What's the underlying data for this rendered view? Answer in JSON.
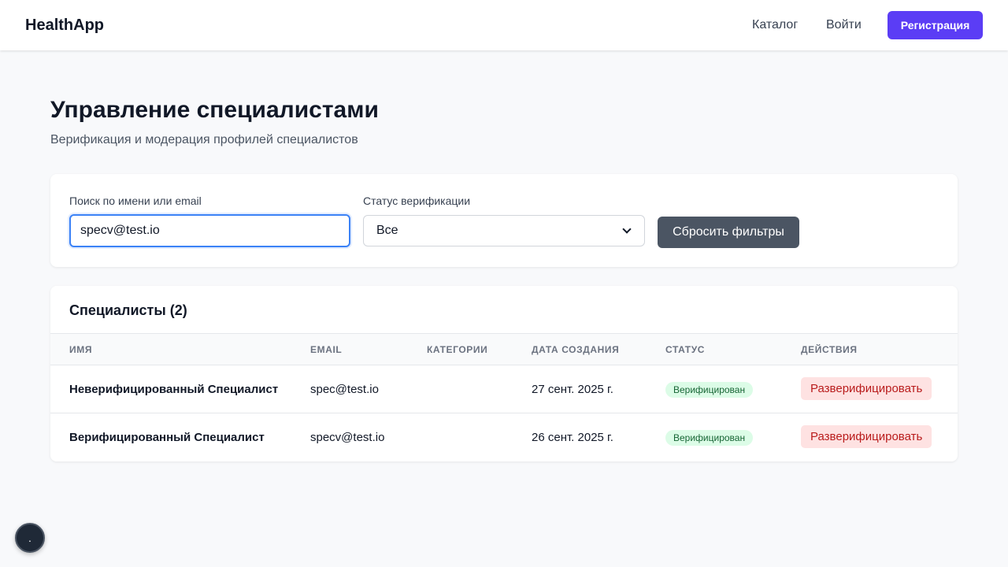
{
  "header": {
    "brand": "HealthApp",
    "nav": {
      "catalog": "Каталог",
      "login": "Войти"
    },
    "register_label": "Регистрация"
  },
  "page": {
    "title": "Управление специалистами",
    "subtitle": "Верификация и модерация профилей специалистов"
  },
  "filters": {
    "search_label": "Поиск по имени или email",
    "search_value": "specv@test.io",
    "status_label": "Статус верификации",
    "status_selected": "Все",
    "reset_label": "Сбросить фильтры"
  },
  "table": {
    "title": "Специалисты (2)",
    "columns": [
      "Имя",
      "Email",
      "Категории",
      "Дата создания",
      "Статус",
      "Действия"
    ],
    "rows": [
      {
        "name": "Неверифицированный Специалист",
        "email": "spec@test.io",
        "categories": "",
        "created": "27 сент. 2025 г.",
        "status": "Верифицирован",
        "action": "Разверифицировать"
      },
      {
        "name": "Верифицированный Специалист",
        "email": "specv@test.io",
        "categories": "",
        "created": "26 сент. 2025 г.",
        "status": "Верифицирован",
        "action": "Разверифицировать"
      }
    ]
  },
  "fab": {
    "label": "."
  },
  "colors": {
    "accent": "#5b3df5",
    "status_bg": "#dcfce7",
    "status_text": "#166534",
    "danger_bg": "#fee2e2",
    "danger_text": "#b91c1c"
  }
}
